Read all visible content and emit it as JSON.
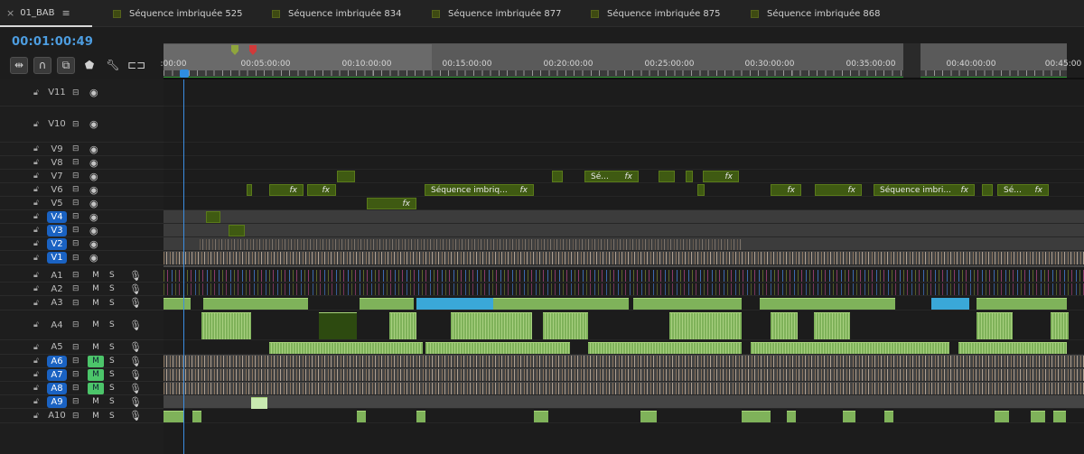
{
  "tabs": [
    {
      "label": "01_BAB",
      "active": true
    },
    {
      "label": "Séquence imbriquée 525"
    },
    {
      "label": "Séquence imbriquée 834"
    },
    {
      "label": "Séquence imbriquée 877"
    },
    {
      "label": "Séquence imbriquée 875"
    },
    {
      "label": "Séquence imbriquée 868"
    }
  ],
  "tab_close": "×",
  "tab_menu": "≡",
  "timecode": "00:01:00:49",
  "ruler_labels": [
    ":00:00",
    "00:05:00:00",
    "00:10:00:00",
    "00:15:00:00",
    "00:20:00:00",
    "00:25:00:00",
    "00:30:00:00",
    "00:35:00:00",
    "00:40:00:00",
    "00:45:00"
  ],
  "video_tracks": [
    {
      "name": "V11",
      "selected": false
    },
    {
      "name": "V10",
      "selected": false
    },
    {
      "name": "V9",
      "selected": false
    },
    {
      "name": "V8",
      "selected": false
    },
    {
      "name": "V7",
      "selected": false
    },
    {
      "name": "V6",
      "selected": false
    },
    {
      "name": "V5",
      "selected": false
    },
    {
      "name": "V4",
      "selected": true
    },
    {
      "name": "V3",
      "selected": true
    },
    {
      "name": "V2",
      "selected": true
    },
    {
      "name": "V1",
      "selected": true
    }
  ],
  "audio_tracks": [
    {
      "name": "A1",
      "selected": false,
      "mute_on": false
    },
    {
      "name": "A2",
      "selected": false,
      "mute_on": false
    },
    {
      "name": "A3",
      "selected": false,
      "mute_on": false
    },
    {
      "name": "A4",
      "selected": false,
      "mute_on": false
    },
    {
      "name": "A5",
      "selected": false,
      "mute_on": false
    },
    {
      "name": "A6",
      "selected": true,
      "mute_on": true
    },
    {
      "name": "A7",
      "selected": true,
      "mute_on": true
    },
    {
      "name": "A8",
      "selected": true,
      "mute_on": true
    },
    {
      "name": "A9",
      "selected": true,
      "mute_on": false
    },
    {
      "name": "A10",
      "selected": false,
      "mute_on": false
    }
  ],
  "mute_label": "M",
  "solo_label": "S",
  "clip_labels": {
    "fx": "fx",
    "seq_short": "Sé...",
    "seq_long": "Séquence imbriq...",
    "seq_long2": "Séquence imbri...",
    "seq_tiny": "Sé..."
  },
  "colors": {
    "accent_blue": "#4d9de0",
    "track_select": "#1a62c2",
    "mute_green": "#4cc56a",
    "video_clip": "#3f5a12",
    "audio_clip": "#7fb25a",
    "audio_blue": "#3aa8d8"
  },
  "icons": {
    "snap": "magnet-icon",
    "linked": "linked-selection-icon",
    "marker": "marker-icon",
    "wrench": "wrench-icon",
    "captions": "captions-icon",
    "lock": "lock-icon",
    "eye": "eye-icon",
    "mic": "microphone-icon"
  }
}
